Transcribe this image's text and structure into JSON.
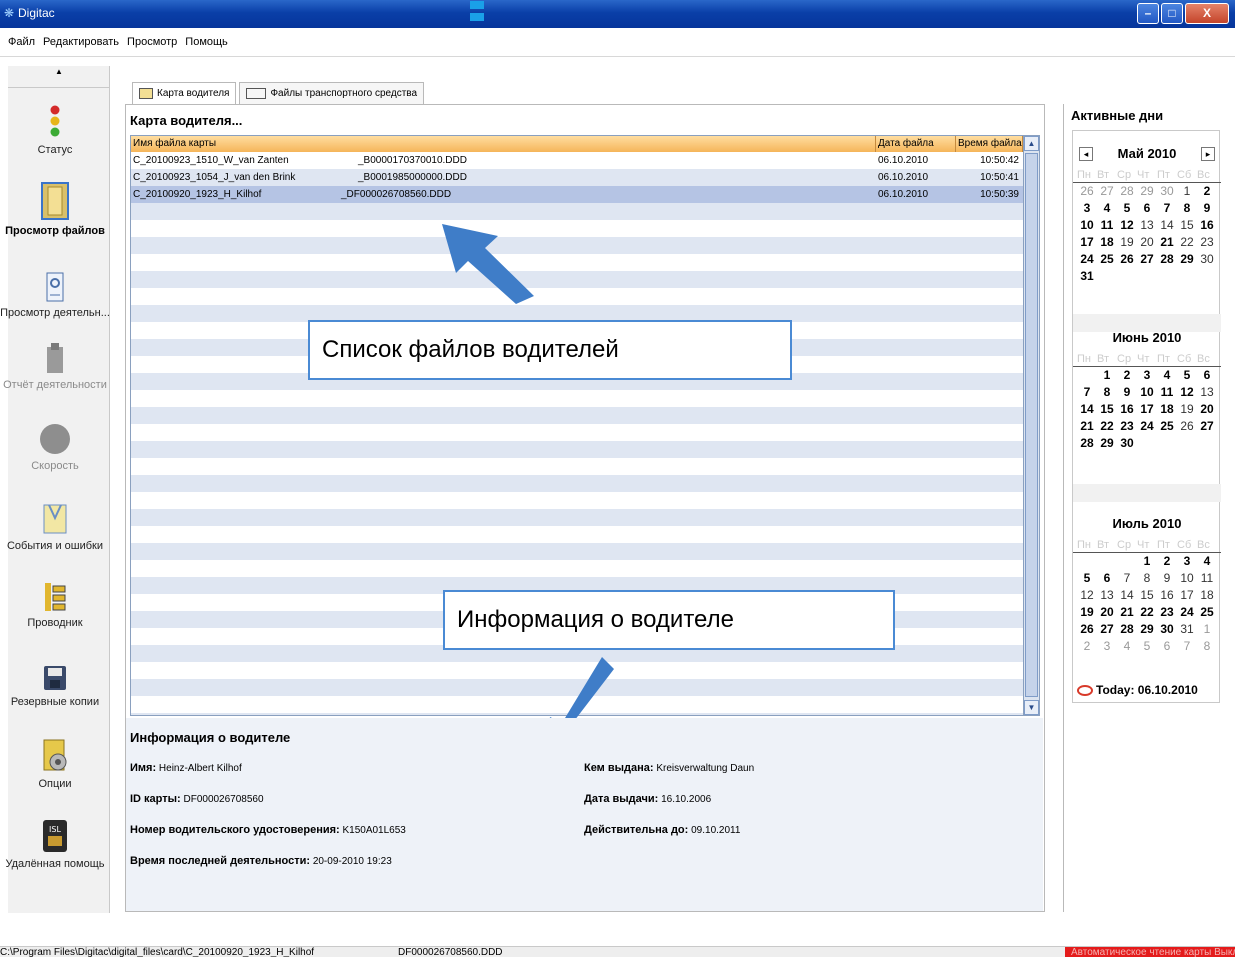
{
  "window": {
    "title": "Digitac"
  },
  "menu": [
    "Файл",
    "Редактировать",
    "Просмотр",
    "Помощь"
  ],
  "sidebar": {
    "items": [
      {
        "label": "Статус",
        "icon": "traffic-light-icon",
        "state": "normal"
      },
      {
        "label": "Просмотр файлов",
        "icon": "folder-icon",
        "state": "active"
      },
      {
        "label": "Просмотр деятельн...",
        "icon": "document-search-icon",
        "state": "normal"
      },
      {
        "label": "Отчёт деятельности",
        "icon": "report-icon",
        "state": "disabled"
      },
      {
        "label": "Скорость",
        "icon": "speed-icon",
        "state": "disabled"
      },
      {
        "label": "События и ошибки",
        "icon": "events-icon",
        "state": "normal"
      },
      {
        "label": "Проводник",
        "icon": "explorer-icon",
        "state": "normal"
      },
      {
        "label": "Резервные копии",
        "icon": "floppy-disk-icon",
        "state": "normal"
      },
      {
        "label": "Опции",
        "icon": "options-icon",
        "state": "normal"
      },
      {
        "label": "Удалённая помощь",
        "icon": "isl-remote-icon",
        "state": "normal"
      }
    ]
  },
  "tabs": [
    {
      "label": "Карта водителя",
      "active": true
    },
    {
      "label": "Файлы транспортного средства",
      "active": false
    }
  ],
  "files": {
    "section_title": "Карта водителя...",
    "columns": [
      "Имя файла карты",
      "Дата файла",
      "Время файла"
    ],
    "rows": [
      {
        "name": "C_20100923_1510_W_van Zanten",
        "suffix": "_B0000170370010.DDD",
        "date": "06.10.2010",
        "time": "10:50:42",
        "selected": false
      },
      {
        "name": "C_20100923_1054_J_van den Brink",
        "suffix": "_B0001985000000.DDD",
        "date": "06.10.2010",
        "time": "10:50:41",
        "selected": false
      },
      {
        "name": "C_20100920_1923_H_Kilhof",
        "suffix": "_DF000026708560.DDD",
        "date": "06.10.2010",
        "time": "10:50:39",
        "selected": true
      }
    ]
  },
  "callouts": {
    "files_list": "Список файлов водителей",
    "driver_info": "Информация о водителе"
  },
  "driver_info": {
    "title": "Информация о водителе",
    "name_label": "Имя:",
    "name": "Heinz-Albert Kilhof",
    "card_label": "ID карты:",
    "card": "DF000026708560",
    "license_label": "Номер водительского удостоверения:",
    "license": "K150A01L653",
    "last_label": "Время последней деятельности:",
    "last": "20-09-2010 19:23",
    "issuer_label": "Кем выдана:",
    "issuer": "Kreisverwaltung Daun",
    "issue_date_label": "Дата выдачи:",
    "issue_date": "16.10.2006",
    "valid_label": "Действительна до:",
    "valid": "09.10.2011"
  },
  "calendar": {
    "title": "Активные дни",
    "weekdays": [
      "Пн",
      "Вт",
      "Ср",
      "Чт",
      "Пт",
      "Сб",
      "Вс"
    ],
    "months": [
      {
        "name": "Май 2010"
      },
      {
        "name": "Июнь 2010"
      },
      {
        "name": "Июль 2010"
      }
    ],
    "today_label": "Today: 06.10.2010"
  },
  "status": {
    "path": "C:\\Program Files\\Digitac\\digital_files\\card\\C_20100920_1923_H_Kilhof",
    "file": "DF000026708560.DDD",
    "auto": "Автоматическое чтение карты Выкл"
  },
  "colors": {
    "titlebar": "#0a3fa8",
    "header": "#f5b55a",
    "selected_row": "#b5c4e4",
    "callout_border": "#4a8ad4",
    "arrow": "#3f7dc8",
    "status_alert": "#e41b1b"
  }
}
